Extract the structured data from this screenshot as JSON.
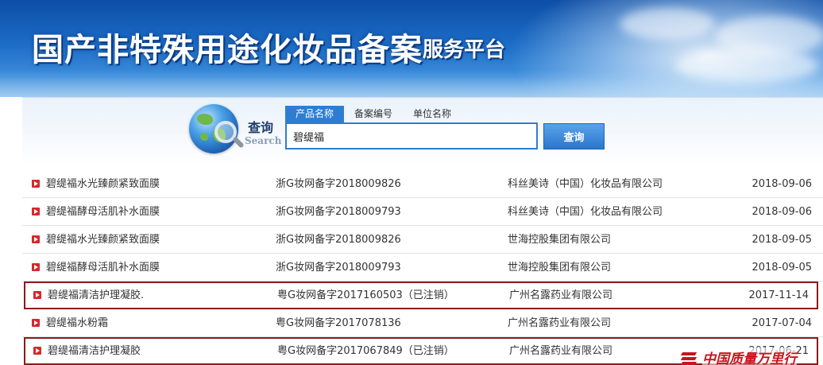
{
  "banner": {
    "title": "国产非特殊用途化妆品备案",
    "subtitle": "服务平台"
  },
  "search": {
    "label_cn": "查询",
    "label_en": "Search",
    "tabs": [
      {
        "label": "产品名称",
        "active": true
      },
      {
        "label": "备案编号",
        "active": false
      },
      {
        "label": "单位名称",
        "active": false
      }
    ],
    "query": "碧缇福",
    "button_label": "查询"
  },
  "results": [
    {
      "name": "碧缇福水光臻颜紧致面膜",
      "reg_no": "浙G妆网备字2018009826",
      "company": "科丝美诗（中国）化妆品有限公司",
      "date": "2018-09-06",
      "highlighted": false
    },
    {
      "name": "碧缇福酵母活肌补水面膜",
      "reg_no": "浙G妆网备字2018009793",
      "company": "科丝美诗（中国）化妆品有限公司",
      "date": "2018-09-06",
      "highlighted": false
    },
    {
      "name": "碧缇福水光臻颜紧致面膜",
      "reg_no": "浙G妆网备字2018009826",
      "company": "世海控股集团有限公司",
      "date": "2018-09-05",
      "highlighted": false
    },
    {
      "name": "碧缇福酵母活肌补水面膜",
      "reg_no": "浙G妆网备字2018009793",
      "company": "世海控股集团有限公司",
      "date": "2018-09-05",
      "highlighted": false
    },
    {
      "name": "碧缇福清洁护理凝胶.",
      "reg_no": "粤G妆网备字2017160503（已注销）",
      "company": "广州名露药业有限公司",
      "date": "2017-11-14",
      "highlighted": true
    },
    {
      "name": "碧缇福水粉霜",
      "reg_no": "粤G妆网备字2017078136",
      "company": "广州名露药业有限公司",
      "date": "2017-07-04",
      "highlighted": false
    },
    {
      "name": "碧缇福清洁护理凝胶",
      "reg_no": "粤G妆网备字2017067849（已注销）",
      "company": "广州名露药业有限公司",
      "date": "2017-06-21",
      "highlighted": true
    }
  ],
  "watermark": {
    "text": "中国质量万里行"
  },
  "colors": {
    "accent": "#2d7ed3",
    "highlight_border": "#8b1a1a",
    "bullet": "#d9262c",
    "watermark": "#c8141e"
  }
}
